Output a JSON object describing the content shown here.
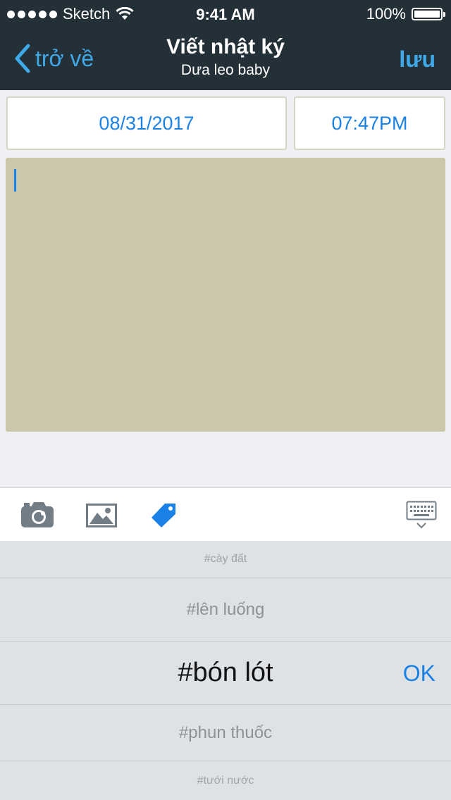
{
  "status_bar": {
    "carrier": "Sketch",
    "time": "9:41 AM",
    "battery": "100%"
  },
  "nav": {
    "back_label": "trở về",
    "title": "Viết nhật ký",
    "subtitle": "Dưa leo baby",
    "save_label": "lưu"
  },
  "form": {
    "date": "08/31/2017",
    "time": "07:47PM",
    "note_text": ""
  },
  "toolbar": {
    "icons": [
      "camera-icon",
      "image-icon",
      "tag-icon",
      "keyboard-dismiss-icon"
    ],
    "active": "tag-icon"
  },
  "picker": {
    "items": [
      "#cày đất",
      "#lên luống",
      "#bón lót",
      "#phun thuốc",
      "#tưới nước"
    ],
    "selected_index": 2,
    "ok_label": "OK"
  },
  "colors": {
    "nav_bg": "#243038",
    "accent": "#1a82e6",
    "nav_accent": "#3ea8e8",
    "note_bg": "#ccc7aa",
    "picker_bg": "#dfe2e5"
  }
}
